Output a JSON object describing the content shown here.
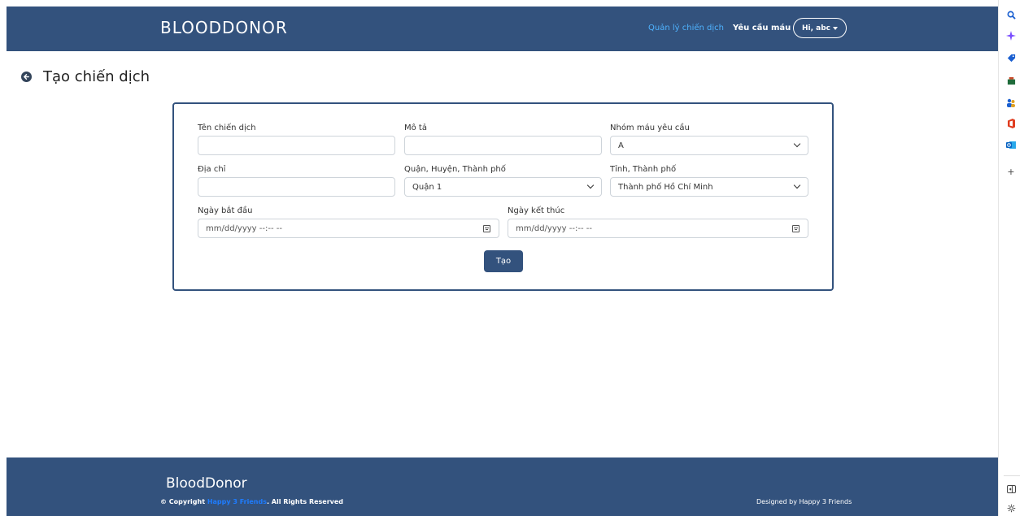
{
  "header": {
    "brand": "BLOODDONOR",
    "nav_campaign": "Quản lý chiến dịch",
    "nav_blood_request": "Yêu cầu máu",
    "user_menu": "Hi, abc"
  },
  "page": {
    "title": "Tạo chiến dịch"
  },
  "form": {
    "campaign_name_label": "Tên chiến dịch",
    "campaign_name_value": "",
    "description_label": "Mô tả",
    "description_value": "",
    "blood_group_label": "Nhóm máu yêu cầu",
    "blood_group_value": "A",
    "address_label": "Địa chỉ",
    "address_value": "",
    "district_label": "Quận, Huyện, Thành phố",
    "district_value": "Quận 1",
    "province_label": "Tỉnh, Thành phố",
    "province_value": "Thành phố Hồ Chí Minh",
    "start_date_label": "Ngày bắt đầu",
    "start_date_placeholder": "mm/dd/yyyy --:-- --",
    "end_date_label": "Ngày kết thúc",
    "end_date_placeholder": "mm/dd/yyyy --:-- --",
    "submit_label": "Tạo"
  },
  "footer": {
    "brand": "BloodDonor",
    "copyright_prefix": "© Copyright ",
    "copyright_link": "Happy 3 Friends",
    "copyright_suffix": ". All Rights Reserved",
    "designed_by": "Designed by Happy 3 Friends"
  },
  "colors": {
    "primary": "#33527d",
    "nav_active": "#4fb3ff",
    "footer_link": "#1e7cff"
  },
  "sidebar_icons": [
    "search-icon",
    "copilot-icon",
    "tag-icon",
    "shopping-icon",
    "people-icon",
    "office-icon",
    "outlook-icon",
    "add-icon",
    "sidebar-toggle-icon",
    "settings-icon"
  ]
}
